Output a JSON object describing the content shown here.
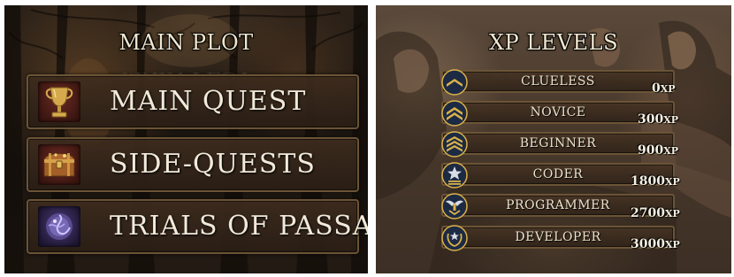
{
  "left_panel": {
    "title": "MAIN PLOT",
    "items": [
      {
        "label": "MAIN QUEST",
        "icon": "trophy-icon"
      },
      {
        "label": "SIDE-QUESTS",
        "icon": "treasure-chest-icon"
      },
      {
        "label": "TRIALS OF PASSAGE",
        "icon": "magic-orb-icon"
      }
    ]
  },
  "right_panel": {
    "title": "XP LEVELS",
    "levels": [
      {
        "name": "CLUELESS",
        "xp": "0",
        "unit": "XP",
        "icon": "rank-chevron-1-icon"
      },
      {
        "name": "NOVICE",
        "xp": "300",
        "unit": "XP",
        "icon": "rank-chevron-2-icon"
      },
      {
        "name": "BEGINNER",
        "xp": "900",
        "unit": "XP",
        "icon": "rank-chevron-3-icon"
      },
      {
        "name": "CODER",
        "xp": "1800",
        "unit": "XP",
        "icon": "rank-star-icon"
      },
      {
        "name": "PROGRAMMER",
        "xp": "2700",
        "unit": "XP",
        "icon": "rank-wings-icon"
      },
      {
        "name": "DEVELOPER",
        "xp": "3000",
        "unit": "XP",
        "icon": "rank-wreath-icon"
      }
    ]
  },
  "colors": {
    "button_border": "#6b5436",
    "text_light": "#f1ead9",
    "badge_gold": "#d9b24a",
    "badge_navy": "#1d2a44"
  }
}
